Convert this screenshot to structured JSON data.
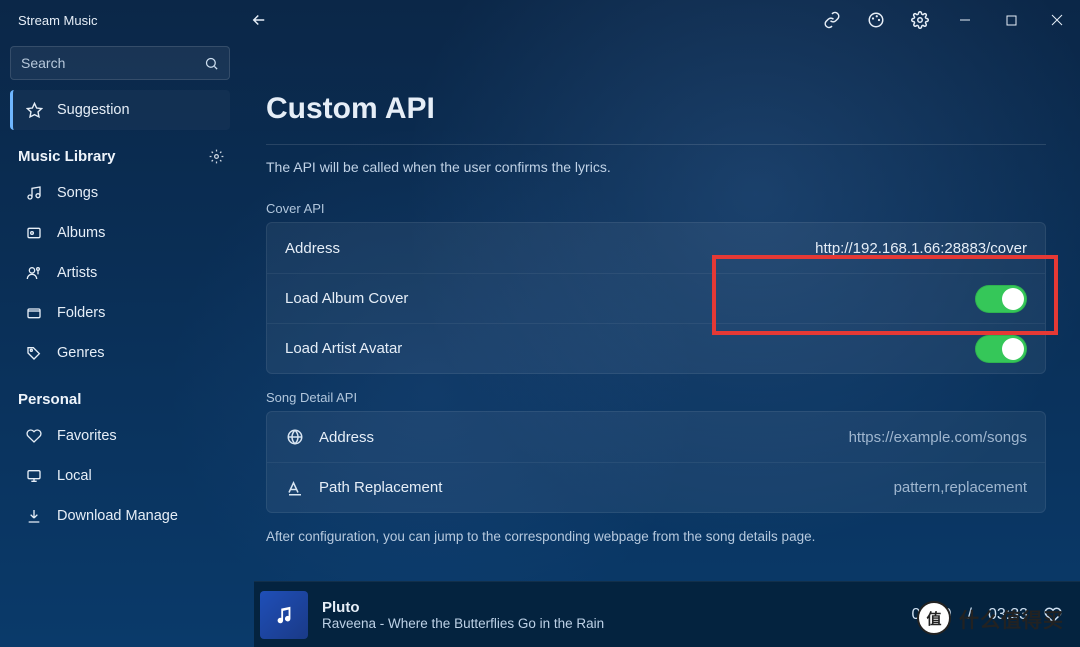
{
  "app": {
    "title": "Stream Music"
  },
  "search": {
    "placeholder": "Search"
  },
  "sidebar": {
    "suggestion": "Suggestion",
    "library_header": "Music Library",
    "items": [
      "Songs",
      "Albums",
      "Artists",
      "Folders",
      "Genres"
    ],
    "personal_header": "Personal",
    "personal": [
      "Favorites",
      "Local",
      "Download Manage"
    ]
  },
  "page": {
    "title": "Custom API",
    "help": "The API will be called when the user confirms the lyrics."
  },
  "cover_api": {
    "group": "Cover API",
    "address_label": "Address",
    "address_value": "http://192.168.1.66:28883/cover",
    "load_album": "Load Album Cover",
    "load_artist": "Load Artist Avatar"
  },
  "song_api": {
    "group": "Song Detail API",
    "address_label": "Address",
    "address_placeholder": "https://example.com/songs",
    "path_label": "Path Replacement",
    "path_placeholder": "pattern,replacement",
    "footnote": "After configuration, you can jump to the corresponding webpage from the song details page."
  },
  "player": {
    "title": "Pluto",
    "artist": "Raveena - Where the Butterflies Go in the Rain",
    "elapsed": "01:50",
    "total": "03:33"
  },
  "watermark": {
    "badge": "值",
    "text": "什么值得买"
  }
}
